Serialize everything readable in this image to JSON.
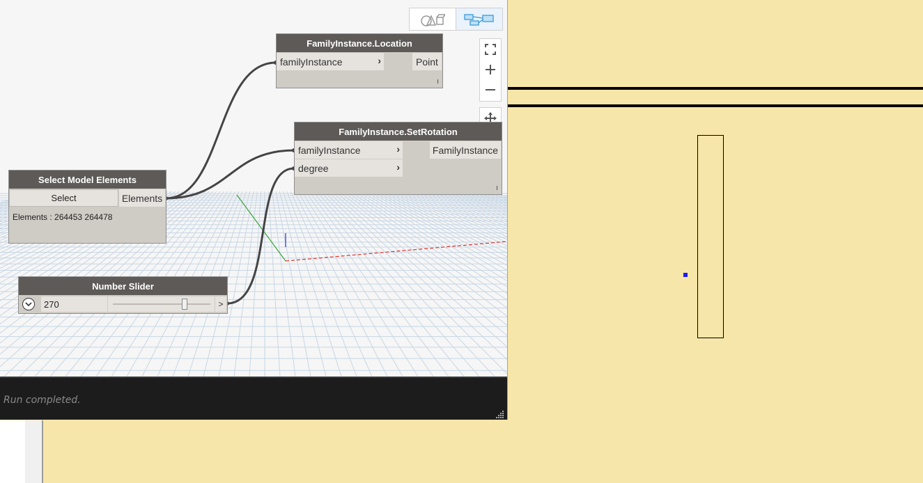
{
  "toolbar": {
    "view_toggle": [
      {
        "icon": "geometry-view-icon",
        "active": false
      },
      {
        "icon": "graph-view-icon",
        "active": true
      }
    ],
    "zoom": [
      {
        "icon": "fit-view-icon"
      },
      {
        "icon": "zoom-in-icon"
      },
      {
        "icon": "zoom-out-icon"
      }
    ],
    "pan_icon": "pan-icon"
  },
  "nodes": {
    "location": {
      "title": "FamilyInstance.Location",
      "input": "familyInstance",
      "output": "Point"
    },
    "set_rotation": {
      "title": "FamilyInstance.SetRotation",
      "inputs": [
        "familyInstance",
        "degree"
      ],
      "output": "FamilyInstance"
    },
    "select": {
      "title": "Select Model Elements",
      "button": "Select",
      "output": "Elements",
      "result": "Elements : 264453 264478"
    },
    "slider": {
      "title": "Number Slider",
      "value": "270",
      "output": ">",
      "level": 0.75
    }
  },
  "status": {
    "text": "Run completed."
  },
  "colors": {
    "revit_background": "#f7e6a9",
    "node_header": "#5d5a57",
    "node_body": "#cfcbc5",
    "wire": "#444444",
    "status_bar": "#1c1c1c",
    "axis_x": "#e0312b",
    "axis_y": "#3aa33a",
    "axis_z": "#2d2de0",
    "point_marker": "#1d1df0"
  }
}
